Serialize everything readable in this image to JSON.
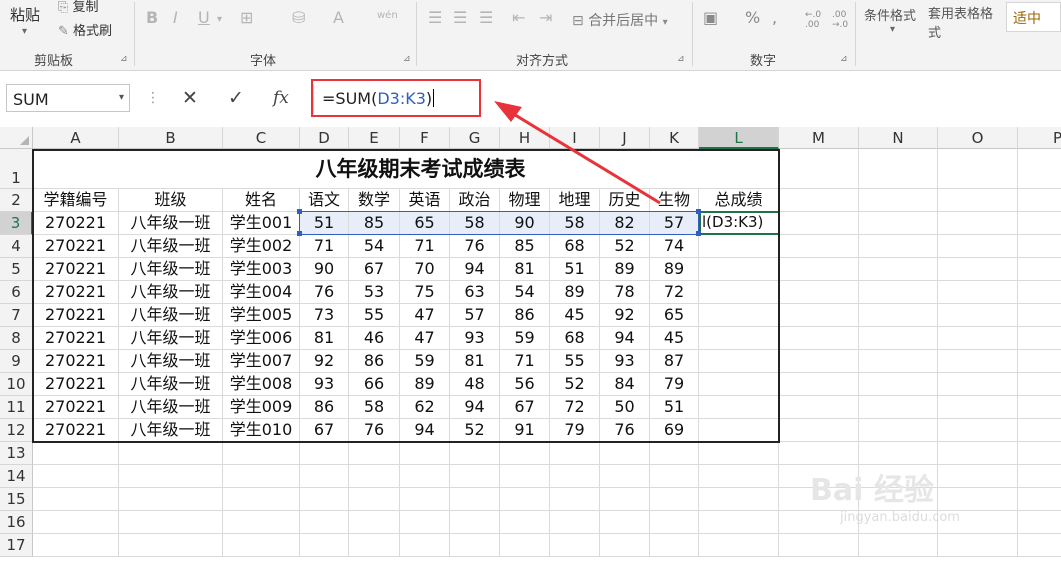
{
  "ribbon": {
    "clipboard": {
      "paste_label": "粘贴",
      "copy_label": "复制",
      "format_painter_label": "格式刷",
      "group_label": "剪贴板"
    },
    "font": {
      "group_label": "字体",
      "bold": "B",
      "italic": "I",
      "underline": "U",
      "font_color_glyph": "A",
      "wen": "wén"
    },
    "alignment": {
      "merge_label": "合并后居中",
      "group_label": "对齐方式"
    },
    "number": {
      "percent": "%",
      "comma": ",",
      "dec_inc": "←.0 .00",
      "dec_dec": ".00 →.0",
      "group_label": "数字"
    },
    "styles": {
      "conditional_label": "条件格式",
      "table_format_label": "套用表格格式",
      "style_box_label": "适中"
    }
  },
  "formula_bar": {
    "name_box": "SUM",
    "cancel_glyph": "✕",
    "enter_glyph": "✓",
    "fx_glyph": "fx",
    "formula_prefix": "=SUM(",
    "formula_ref": "D3:K3",
    "formula_suffix": ")"
  },
  "columns": [
    "A",
    "B",
    "C",
    "D",
    "E",
    "F",
    "G",
    "H",
    "I",
    "J",
    "K",
    "L",
    "M",
    "N",
    "O",
    "P"
  ],
  "rows": [
    "1",
    "2",
    "3",
    "4",
    "5",
    "6",
    "7",
    "8",
    "9",
    "10",
    "11",
    "12",
    "13",
    "14",
    "15",
    "16",
    "17"
  ],
  "table": {
    "title": "八年级期末考试成绩表",
    "headers": [
      "学籍编号",
      "班级",
      "姓名",
      "语文",
      "数学",
      "英语",
      "政治",
      "物理",
      "地理",
      "历史",
      "生物",
      "总成绩"
    ],
    "records": [
      [
        "270221",
        "八年级一班",
        "学生001",
        "51",
        "85",
        "65",
        "58",
        "90",
        "58",
        "82",
        "57"
      ],
      [
        "270221",
        "八年级一班",
        "学生002",
        "71",
        "54",
        "71",
        "76",
        "85",
        "68",
        "52",
        "74"
      ],
      [
        "270221",
        "八年级一班",
        "学生003",
        "90",
        "67",
        "70",
        "94",
        "81",
        "51",
        "89",
        "89"
      ],
      [
        "270221",
        "八年级一班",
        "学生004",
        "76",
        "53",
        "75",
        "63",
        "54",
        "89",
        "78",
        "72"
      ],
      [
        "270221",
        "八年级一班",
        "学生005",
        "73",
        "55",
        "47",
        "57",
        "86",
        "45",
        "92",
        "65"
      ],
      [
        "270221",
        "八年级一班",
        "学生006",
        "81",
        "46",
        "47",
        "93",
        "59",
        "68",
        "94",
        "45"
      ],
      [
        "270221",
        "八年级一班",
        "学生007",
        "92",
        "86",
        "59",
        "81",
        "71",
        "55",
        "93",
        "87"
      ],
      [
        "270221",
        "八年级一班",
        "学生008",
        "93",
        "66",
        "89",
        "48",
        "56",
        "52",
        "84",
        "79"
      ],
      [
        "270221",
        "八年级一班",
        "学生009",
        "86",
        "58",
        "62",
        "94",
        "67",
        "72",
        "50",
        "51"
      ],
      [
        "270221",
        "八年级一班",
        "学生010",
        "67",
        "76",
        "94",
        "52",
        "91",
        "79",
        "76",
        "69"
      ]
    ],
    "editing_cell_text": "l(D3:K3)"
  },
  "colors": {
    "accent_green": "#217346",
    "formula_ref_blue": "#2f5fbf",
    "annotation_red": "#e8333a",
    "range_fill": "#e8eef9"
  },
  "watermark": {
    "main": "Bai 经验",
    "sub": "jingyan.baidu.com"
  }
}
